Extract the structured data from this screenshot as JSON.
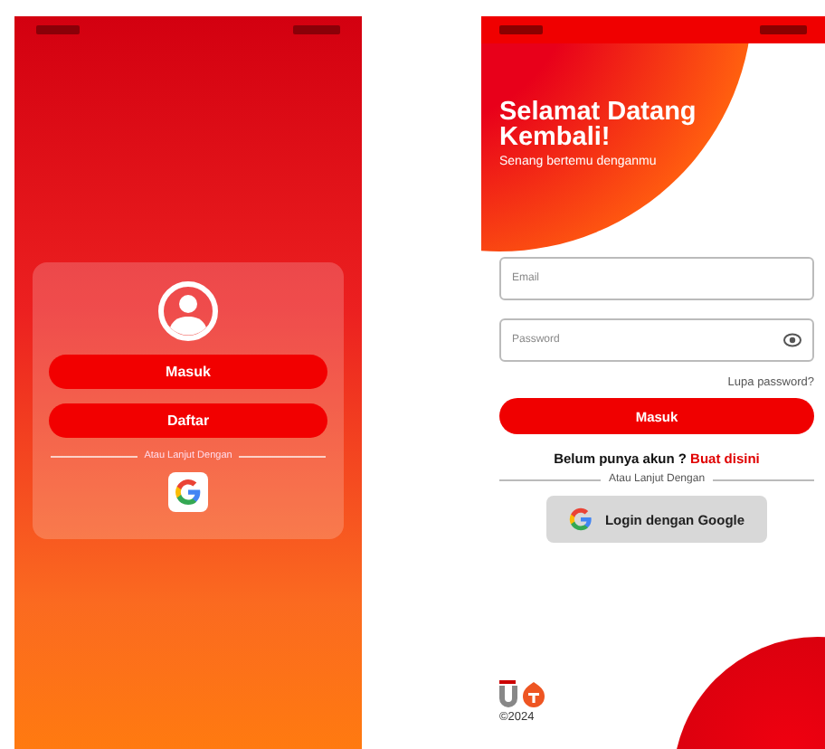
{
  "welcome_screen": {
    "buttons": [
      {
        "label": "Masuk"
      },
      {
        "label": "Daftar"
      }
    ],
    "divider_text": "Atau Lanjut Dengan"
  },
  "login_screen": {
    "title": "Selamat Datang Kembali!",
    "subtitle": "Senang bertemu denganmu",
    "fields": [
      {
        "placeholder": "Email",
        "kind": "text"
      },
      {
        "placeholder": "Password",
        "kind": "password"
      }
    ],
    "forgot_link": "Lupa password?",
    "submit": "Masuk",
    "signup_prompt": "Belum punya akun ?",
    "signup_link": "Buat disini",
    "divider_text": "Atau Lanjut Dengan",
    "google_button": "Login dengan Google",
    "copyright": "©2024"
  }
}
